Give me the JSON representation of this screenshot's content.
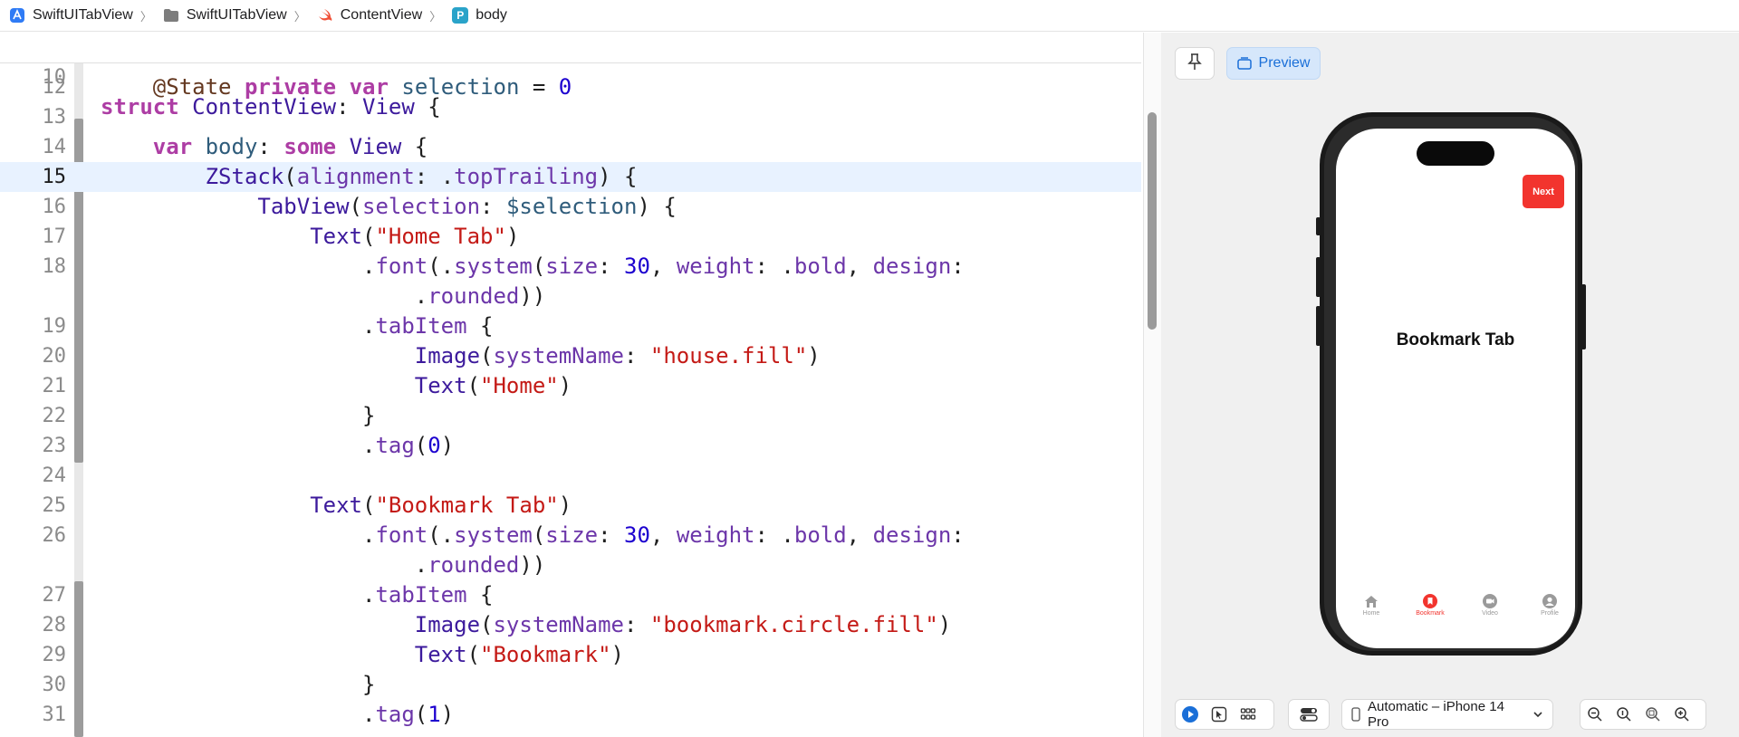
{
  "breadcrumb": {
    "items": [
      {
        "label": "SwiftUITabView",
        "icon": "app-project-icon"
      },
      {
        "label": "SwiftUITabView",
        "icon": "folder-icon"
      },
      {
        "label": "ContentView",
        "icon": "swift-file-icon"
      },
      {
        "label": "body",
        "icon": "property-icon"
      }
    ],
    "property_badge": "P"
  },
  "editor": {
    "sticky_line": {
      "num": "10"
    },
    "lines": [
      {
        "num": "12"
      },
      {
        "num": "13"
      },
      {
        "num": "14"
      },
      {
        "num": "15"
      },
      {
        "num": "16"
      },
      {
        "num": "17"
      },
      {
        "num": "18"
      },
      {
        "num": ""
      },
      {
        "num": "19"
      },
      {
        "num": "20"
      },
      {
        "num": "21"
      },
      {
        "num": "22"
      },
      {
        "num": "23"
      },
      {
        "num": "24"
      },
      {
        "num": "25"
      },
      {
        "num": "26"
      },
      {
        "num": ""
      },
      {
        "num": "27"
      },
      {
        "num": "28"
      },
      {
        "num": "29"
      },
      {
        "num": "30"
      },
      {
        "num": "31"
      }
    ],
    "active_line": "15"
  },
  "canvas": {
    "pin_icon": "pin-icon",
    "preview_label": "Preview",
    "preview_icon": "preview-device-icon",
    "device_selector": "Automatic – iPhone 14 Pro"
  },
  "app_preview": {
    "next_button": "Next",
    "title": "Bookmark Tab",
    "tabs": [
      {
        "label": "Home",
        "icon": "house-fill-icon",
        "selected": false
      },
      {
        "label": "Bookmark",
        "icon": "bookmark-circle-fill-icon",
        "selected": true
      },
      {
        "label": "Video",
        "icon": "video-circle-fill-icon",
        "selected": false
      },
      {
        "label": "Profile",
        "icon": "person-circle-fill-icon",
        "selected": false
      }
    ],
    "accent_color": "#f2342e"
  }
}
